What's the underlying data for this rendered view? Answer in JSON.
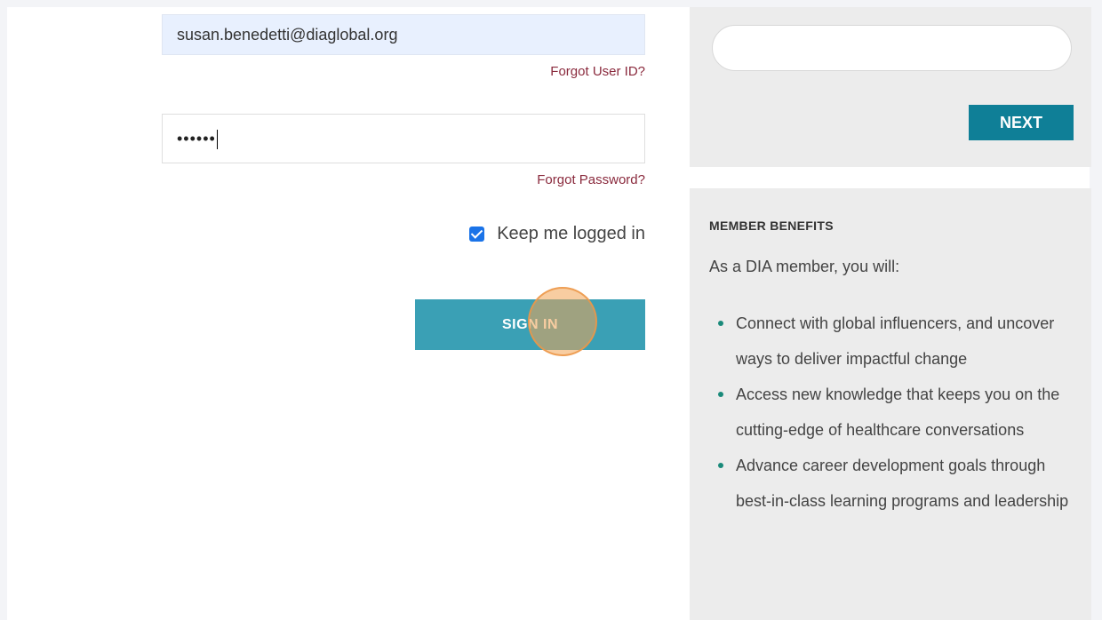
{
  "login": {
    "email_value": "susan.benedetti@diaglobal.org",
    "forgot_userid_label": "Forgot User ID?",
    "password_value": "••••••",
    "forgot_password_label": "Forgot Password?",
    "keep_logged_in_label": "Keep me logged in",
    "keep_logged_in_checked": true,
    "signin_label": "SIGN IN"
  },
  "lookup": {
    "input_value": "",
    "next_label": "NEXT"
  },
  "benefits": {
    "title": "MEMBER BENEFITS",
    "intro": "As a DIA member, you will:",
    "items": [
      {
        "text": "Connect with global influencers, and uncover ways to deliver impactful change"
      },
      {
        "text": "Access new knowledge that keeps you on the cutting-edge of healthcare conversations"
      },
      {
        "text": "Advance career development goals through best-in-class learning programs and leadership"
      }
    ]
  },
  "colors": {
    "signin_button": "#3aa0b5",
    "next_button": "#0f7f97",
    "link": "#8a2a3d",
    "panel_bg": "#ececec"
  }
}
